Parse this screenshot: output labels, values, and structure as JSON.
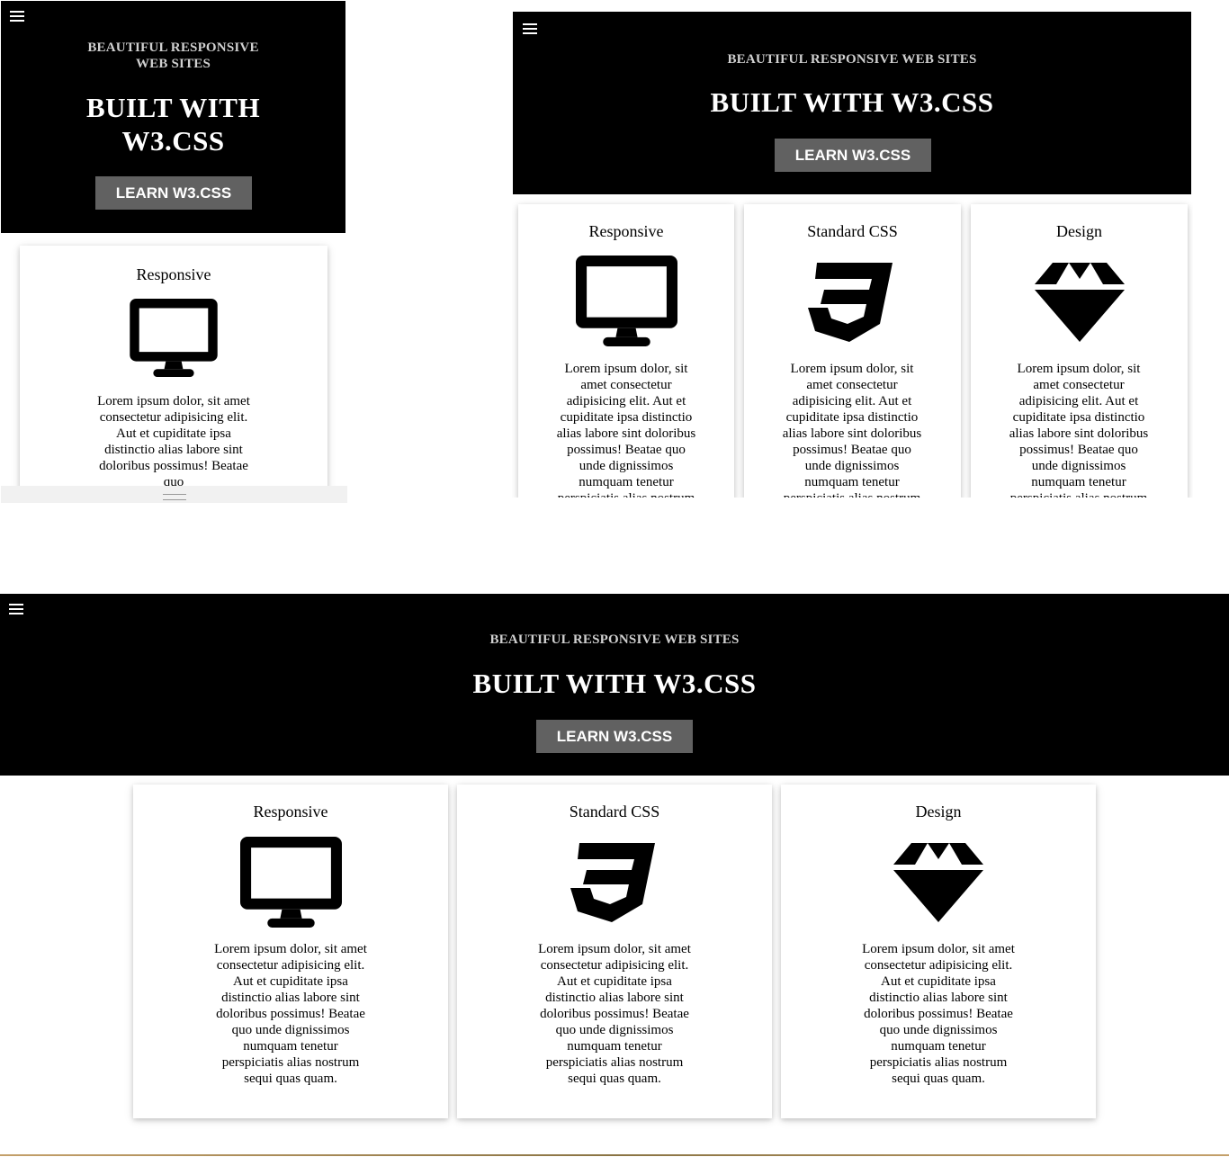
{
  "hero": {
    "subtitle": "BEAUTIFUL RESPONSIVE WEB SITES",
    "title": "BUILT WITH W3.CSS",
    "button_label": "LEARN W3.CSS",
    "menu_icon": "hamburger-menu-icon"
  },
  "cards": [
    {
      "title": "Responsive",
      "icon": "desktop-monitor-icon",
      "text": "Lorem ipsum dolor, sit amet consectetur adipisicing elit. Aut et cupiditate ipsa distinctio alias labore sint doloribus possimus! Beatae quo unde dignissimos numquam tenetur perspiciatis alias nostrum sequi quas quam."
    },
    {
      "title": "Standard CSS",
      "icon": "css3-logo-icon",
      "text": "Lorem ipsum dolor, sit amet consectetur adipisicing elit. Aut et cupiditate ipsa distinctio alias labore sint doloribus possimus! Beatae quo unde dignissimos numquam tenetur perspiciatis alias nostrum sequi quas quam."
    },
    {
      "title": "Design",
      "icon": "diamond-icon",
      "text": "Lorem ipsum dolor, sit amet consectetur adipisicing elit. Aut et cupiditate ipsa distinctio alias labore sint doloribus possimus! Beatae quo unde dignissimos numquam tenetur perspiciatis alias nostrum sequi quas quam."
    }
  ],
  "mobile_text": "Lorem ipsum dolor, sit amet consectetur adipisicing elit. Aut et cupiditate ipsa distinctio alias labore sint doloribus possimus! Beatae quo",
  "colors": {
    "hero_bg": "#000000",
    "button_bg": "#616161",
    "subtitle": "#d0d0d0"
  }
}
